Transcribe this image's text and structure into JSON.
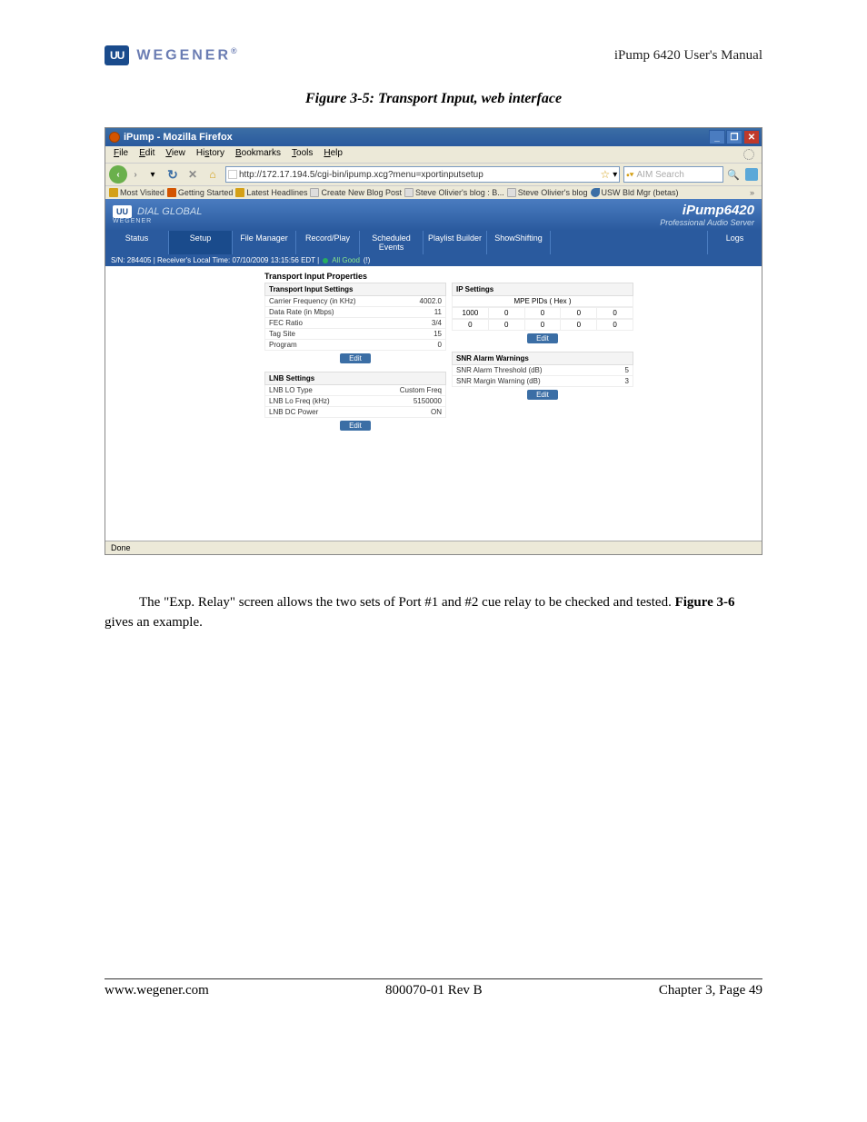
{
  "header": {
    "brand": "WEGENER",
    "manual": "iPump 6420 User's Manual"
  },
  "figure_caption": "Figure 3-5:  Transport Input, web interface",
  "window": {
    "title": "iPump - Mozilla Firefox",
    "menus": {
      "file": "File",
      "edit": "Edit",
      "view": "View",
      "history": "History",
      "bookmarks": "Bookmarks",
      "tools": "Tools",
      "help": "Help"
    },
    "url": "http://172.17.194.5/cgi-bin/ipump.xcg?menu=xportinputsetup",
    "search_placeholder": "AIM Search",
    "bookmarks_bar": {
      "most_visited": "Most Visited",
      "getting_started": "Getting Started",
      "latest_headlines": "Latest Headlines",
      "create_blog": "Create New Blog Post",
      "olivier1": "Steve Olivier's blog : B...",
      "olivier2": "Steve Olivier's blog",
      "usw": "USW Bld Mgr (betas)"
    },
    "status_bar": "Done"
  },
  "app": {
    "logo_uu": "UU",
    "dial_global": "DIAL GLOBAL",
    "weg": "WEGENER",
    "title": "iPump6420",
    "subtitle": "Professional Audio Server",
    "tabs": {
      "status": "Status",
      "setup": "Setup",
      "file_manager": "File Manager",
      "record_play": "Record/Play",
      "scheduled_events": "Scheduled Events",
      "playlist_builder": "Playlist Builder",
      "showshifting": "ShowShifting",
      "logs": "Logs"
    },
    "status_line": {
      "sn": "S/N: 284405  |  Receiver's Local Time: 07/10/2009 13:15:56 EDT  |",
      "good": "All Good",
      "refresh": "(!)"
    }
  },
  "content": {
    "title": "Transport Input Properties",
    "tis": {
      "head": "Transport Input Settings",
      "rows": {
        "r0": {
          "l": "Carrier Frequency (in KHz)",
          "v": "4002.0"
        },
        "r1": {
          "l": "Data Rate (in Mbps)",
          "v": "11"
        },
        "r2": {
          "l": "FEC Ratio",
          "v": "3/4"
        },
        "r3": {
          "l": "Tag Site",
          "v": "15"
        },
        "r4": {
          "l": "Program",
          "v": "0"
        }
      },
      "edit": "Edit"
    },
    "lnb": {
      "head": "LNB Settings",
      "rows": {
        "r0": {
          "l": "LNB LO Type",
          "v": "Custom Freq"
        },
        "r1": {
          "l": "LNB Lo Freq (kHz)",
          "v": "5150000"
        },
        "r2": {
          "l": "LNB DC Power",
          "v": "ON"
        }
      },
      "edit": "Edit"
    },
    "ip": {
      "head": "IP Settings",
      "mpe_label": "MPE PIDs ( Hex )",
      "row1": {
        "c0": "1000",
        "c1": "0",
        "c2": "0",
        "c3": "0",
        "c4": "0"
      },
      "row2": {
        "c0": "0",
        "c1": "0",
        "c2": "0",
        "c3": "0",
        "c4": "0"
      },
      "edit": "Edit"
    },
    "snr": {
      "head": "SNR Alarm Warnings",
      "rows": {
        "r0": {
          "l": "SNR Alarm Threshold (dB)",
          "v": "5"
        },
        "r1": {
          "l": "SNR Margin Warning (dB)",
          "v": "3"
        }
      },
      "edit": "Edit"
    }
  },
  "body_text": {
    "p1a": "The \"Exp. Relay\" screen allows the two sets of Port #1 and #2 cue relay to be checked and tested.  ",
    "p1b": "Figure 3-6",
    "p1c": " gives an example."
  },
  "footer": {
    "left": "www.wegener.com",
    "center": "800070-01 Rev B",
    "right": "Chapter 3, Page 49"
  }
}
